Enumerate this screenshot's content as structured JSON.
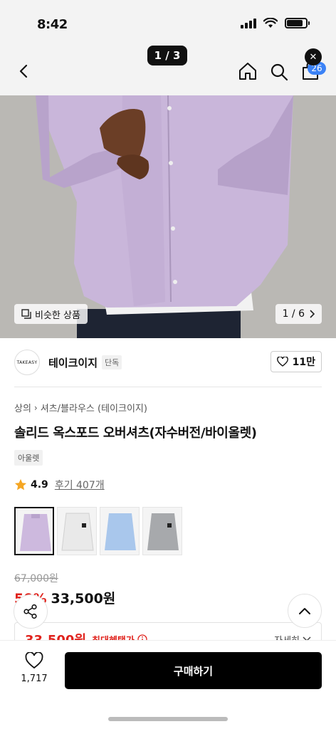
{
  "status_bar": {
    "time": "8:42"
  },
  "image_pager": {
    "label": "1 / 3"
  },
  "nav": {
    "cart_badge": "26"
  },
  "hero": {
    "similar_label": "비슷한 상품",
    "counter": "1 / 6"
  },
  "brand": {
    "logo_text": "TAKEASY",
    "name": "테이크이지",
    "tag": "단독",
    "likes": "11만"
  },
  "breadcrumb": {
    "level1": "상의",
    "level2": "셔츠/블라우스 (테이크이지)"
  },
  "product": {
    "title": "솔리드 옥스포드 오버셔츠(자수버전/바이올렛)",
    "color_chip": "아울렛"
  },
  "rating": {
    "score": "4.9",
    "reviews": "후기 407개"
  },
  "price": {
    "original": "67,000원",
    "discount": "50%",
    "sale": "33,500원"
  },
  "benefit": {
    "price": "33,500원",
    "label": "최대혜택가",
    "more": "자세히"
  },
  "bottom": {
    "wish_count": "1,717",
    "buy_label": "구매하기"
  },
  "colors": {
    "accent_red": "#e0221c",
    "badge_blue": "#3b82f6",
    "shirt_lavender": "#c9b6da"
  }
}
